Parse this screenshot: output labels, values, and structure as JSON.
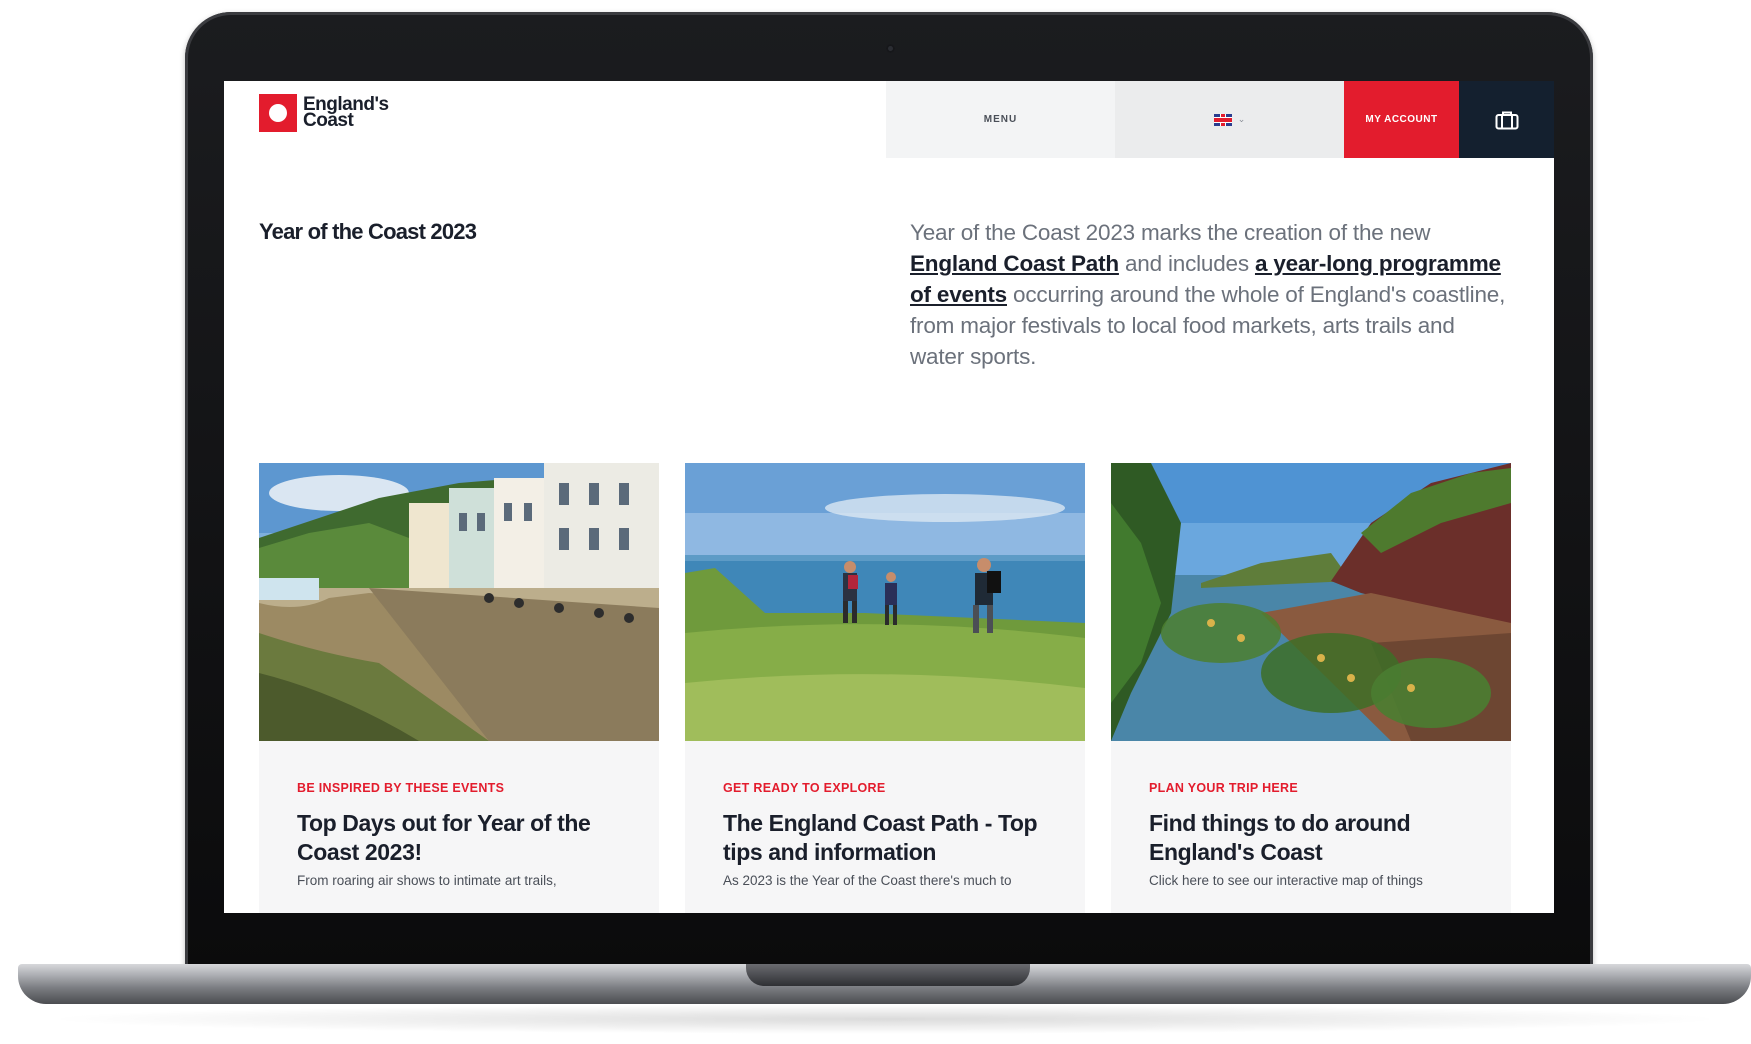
{
  "header": {
    "logo_line1": "England's",
    "logo_line2": "Coast",
    "menu_label": "MENU",
    "account_label": "MY ACCOUNT"
  },
  "intro": {
    "page_title": "Year of the Coast 2023",
    "text_1": "Year of the Coast 2023 marks the creation of the new ",
    "link_1": "England Coast Path",
    "text_2": " and includes ",
    "link_2": "a year-long programme of events",
    "text_3": " occurring around the whole of England's coastline, from major festivals to local food markets, arts trails and water sports."
  },
  "cards": [
    {
      "kicker": "BE INSPIRED BY THESE EVENTS",
      "title": "Top Days out for Year of the Coast 2023!",
      "excerpt": "From roaring air shows to intimate art trails,"
    },
    {
      "kicker": "GET READY TO EXPLORE",
      "title": "The England Coast Path - Top tips and information",
      "excerpt": "As 2023 is the Year of the Coast there's much to"
    },
    {
      "kicker": "PLAN YOUR TRIP HERE",
      "title": "Find things to do around England's Coast",
      "excerpt": "Click here to see our interactive map of things"
    }
  ],
  "colors": {
    "brand_red": "#e31c2d",
    "navy": "#14202f",
    "text_dark": "#1a1f2b"
  },
  "icons": [
    "logo-mark",
    "uk-flag-icon",
    "chevron-down-icon",
    "bag-icon"
  ]
}
